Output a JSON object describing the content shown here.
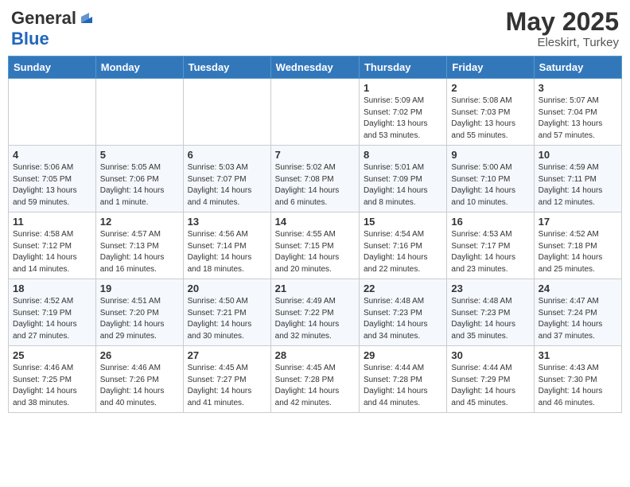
{
  "header": {
    "logo_general": "General",
    "logo_blue": "Blue",
    "month": "May 2025",
    "location": "Eleskirt, Turkey"
  },
  "weekdays": [
    "Sunday",
    "Monday",
    "Tuesday",
    "Wednesday",
    "Thursday",
    "Friday",
    "Saturday"
  ],
  "weeks": [
    [
      {
        "day": "",
        "info": ""
      },
      {
        "day": "",
        "info": ""
      },
      {
        "day": "",
        "info": ""
      },
      {
        "day": "",
        "info": ""
      },
      {
        "day": "1",
        "info": "Sunrise: 5:09 AM\nSunset: 7:02 PM\nDaylight: 13 hours\nand 53 minutes."
      },
      {
        "day": "2",
        "info": "Sunrise: 5:08 AM\nSunset: 7:03 PM\nDaylight: 13 hours\nand 55 minutes."
      },
      {
        "day": "3",
        "info": "Sunrise: 5:07 AM\nSunset: 7:04 PM\nDaylight: 13 hours\nand 57 minutes."
      }
    ],
    [
      {
        "day": "4",
        "info": "Sunrise: 5:06 AM\nSunset: 7:05 PM\nDaylight: 13 hours\nand 59 minutes."
      },
      {
        "day": "5",
        "info": "Sunrise: 5:05 AM\nSunset: 7:06 PM\nDaylight: 14 hours\nand 1 minute."
      },
      {
        "day": "6",
        "info": "Sunrise: 5:03 AM\nSunset: 7:07 PM\nDaylight: 14 hours\nand 4 minutes."
      },
      {
        "day": "7",
        "info": "Sunrise: 5:02 AM\nSunset: 7:08 PM\nDaylight: 14 hours\nand 6 minutes."
      },
      {
        "day": "8",
        "info": "Sunrise: 5:01 AM\nSunset: 7:09 PM\nDaylight: 14 hours\nand 8 minutes."
      },
      {
        "day": "9",
        "info": "Sunrise: 5:00 AM\nSunset: 7:10 PM\nDaylight: 14 hours\nand 10 minutes."
      },
      {
        "day": "10",
        "info": "Sunrise: 4:59 AM\nSunset: 7:11 PM\nDaylight: 14 hours\nand 12 minutes."
      }
    ],
    [
      {
        "day": "11",
        "info": "Sunrise: 4:58 AM\nSunset: 7:12 PM\nDaylight: 14 hours\nand 14 minutes."
      },
      {
        "day": "12",
        "info": "Sunrise: 4:57 AM\nSunset: 7:13 PM\nDaylight: 14 hours\nand 16 minutes."
      },
      {
        "day": "13",
        "info": "Sunrise: 4:56 AM\nSunset: 7:14 PM\nDaylight: 14 hours\nand 18 minutes."
      },
      {
        "day": "14",
        "info": "Sunrise: 4:55 AM\nSunset: 7:15 PM\nDaylight: 14 hours\nand 20 minutes."
      },
      {
        "day": "15",
        "info": "Sunrise: 4:54 AM\nSunset: 7:16 PM\nDaylight: 14 hours\nand 22 minutes."
      },
      {
        "day": "16",
        "info": "Sunrise: 4:53 AM\nSunset: 7:17 PM\nDaylight: 14 hours\nand 23 minutes."
      },
      {
        "day": "17",
        "info": "Sunrise: 4:52 AM\nSunset: 7:18 PM\nDaylight: 14 hours\nand 25 minutes."
      }
    ],
    [
      {
        "day": "18",
        "info": "Sunrise: 4:52 AM\nSunset: 7:19 PM\nDaylight: 14 hours\nand 27 minutes."
      },
      {
        "day": "19",
        "info": "Sunrise: 4:51 AM\nSunset: 7:20 PM\nDaylight: 14 hours\nand 29 minutes."
      },
      {
        "day": "20",
        "info": "Sunrise: 4:50 AM\nSunset: 7:21 PM\nDaylight: 14 hours\nand 30 minutes."
      },
      {
        "day": "21",
        "info": "Sunrise: 4:49 AM\nSunset: 7:22 PM\nDaylight: 14 hours\nand 32 minutes."
      },
      {
        "day": "22",
        "info": "Sunrise: 4:48 AM\nSunset: 7:23 PM\nDaylight: 14 hours\nand 34 minutes."
      },
      {
        "day": "23",
        "info": "Sunrise: 4:48 AM\nSunset: 7:23 PM\nDaylight: 14 hours\nand 35 minutes."
      },
      {
        "day": "24",
        "info": "Sunrise: 4:47 AM\nSunset: 7:24 PM\nDaylight: 14 hours\nand 37 minutes."
      }
    ],
    [
      {
        "day": "25",
        "info": "Sunrise: 4:46 AM\nSunset: 7:25 PM\nDaylight: 14 hours\nand 38 minutes."
      },
      {
        "day": "26",
        "info": "Sunrise: 4:46 AM\nSunset: 7:26 PM\nDaylight: 14 hours\nand 40 minutes."
      },
      {
        "day": "27",
        "info": "Sunrise: 4:45 AM\nSunset: 7:27 PM\nDaylight: 14 hours\nand 41 minutes."
      },
      {
        "day": "28",
        "info": "Sunrise: 4:45 AM\nSunset: 7:28 PM\nDaylight: 14 hours\nand 42 minutes."
      },
      {
        "day": "29",
        "info": "Sunrise: 4:44 AM\nSunset: 7:28 PM\nDaylight: 14 hours\nand 44 minutes."
      },
      {
        "day": "30",
        "info": "Sunrise: 4:44 AM\nSunset: 7:29 PM\nDaylight: 14 hours\nand 45 minutes."
      },
      {
        "day": "31",
        "info": "Sunrise: 4:43 AM\nSunset: 7:30 PM\nDaylight: 14 hours\nand 46 minutes."
      }
    ]
  ]
}
